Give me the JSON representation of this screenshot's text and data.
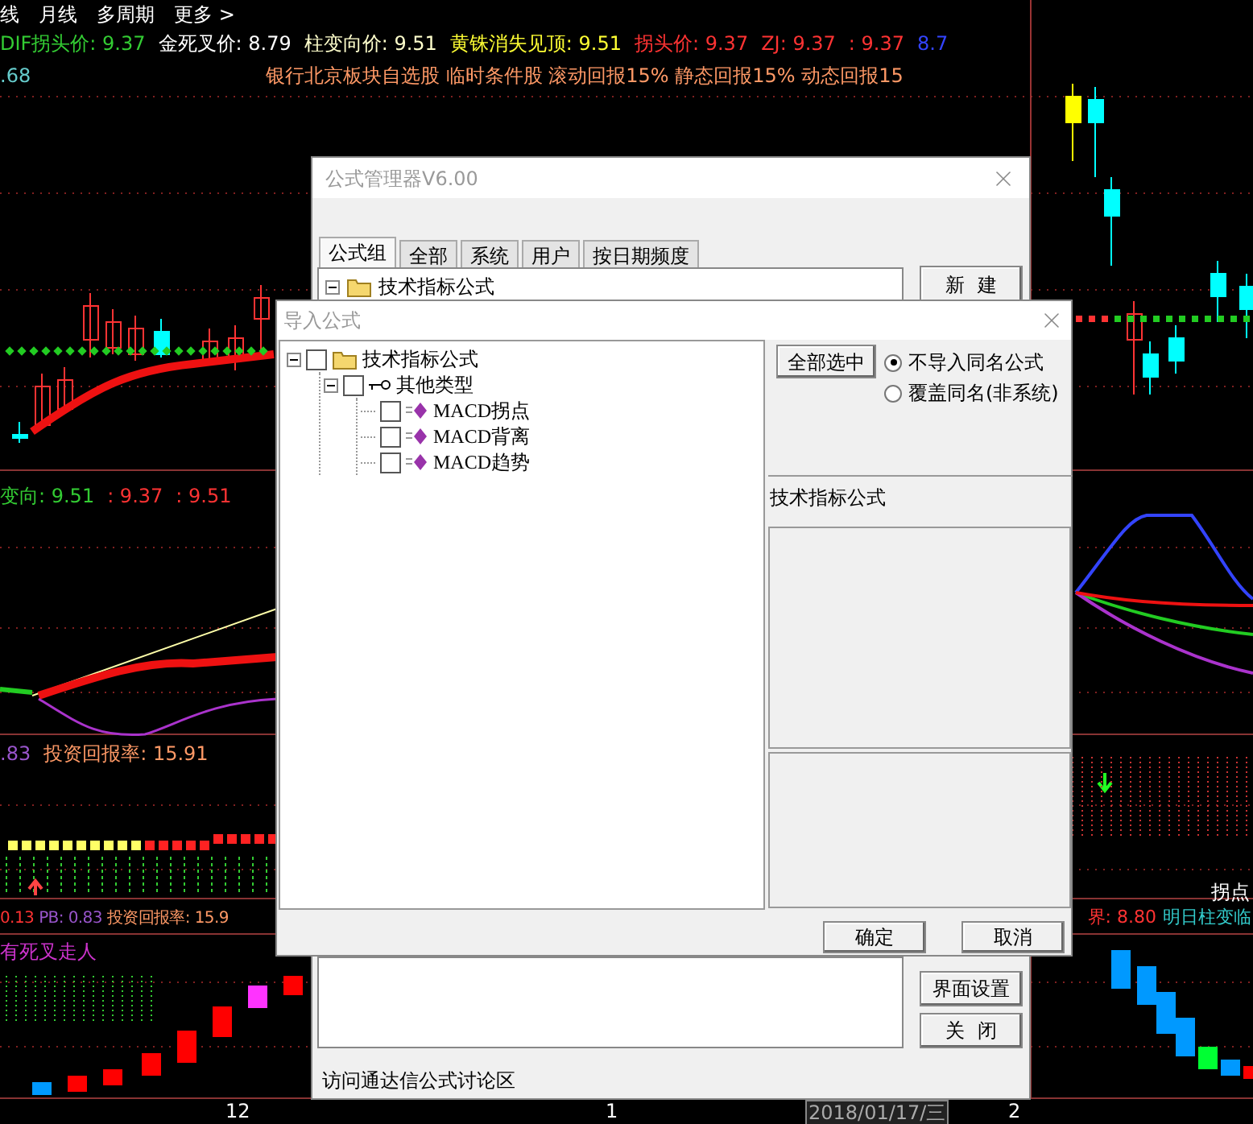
{
  "toolbar": [
    "线",
    "月线",
    "多周期",
    "更多 >"
  ],
  "main_legend": [
    {
      "text": "DIF拐头价: 9.37",
      "color": "#33cc33"
    },
    {
      "text": "金死叉价: 8.79",
      "color": "#ffffff"
    },
    {
      "text": "柱变向价: 9.51",
      "color": "#ffffcc"
    },
    {
      "text": "黄铢消失见顶: 9.51",
      "color": "#ffff33"
    },
    {
      "text": "拐头价: 9.37",
      "color": "#ff3333"
    },
    {
      "text": "ZJ: 9.37",
      "color": "#ff3333"
    },
    {
      "text": ": 9.37",
      "color": "#ff3333"
    },
    {
      "text": "8.7",
      "color": "#3344ff"
    }
  ],
  "main_sub_value": ".68",
  "stock_info": "银行北京板块自选股 临时条件股 滚动回报15% 静态回报15% 动态回报15",
  "panel2_legend": [
    {
      "text": "变向: 9.51",
      "color": "#33cc33"
    },
    {
      "text": ": 9.37",
      "color": "#ff3333"
    },
    {
      "text": ": 9.51",
      "color": "#ff3333"
    }
  ],
  "panel3_legend": [
    {
      "text": ".83",
      "color": "#9955cc"
    },
    {
      "text": "投资回报率: 15.91",
      "color": "#ff9966"
    }
  ],
  "panel3_right": "拐点",
  "panel4_legend": [
    {
      "text": "0.13",
      "color": "#ff3333"
    },
    {
      "text": "PB: 0.83",
      "color": "#9955cc"
    },
    {
      "text": "投资回报率: 15.9",
      "color": "#ff9966"
    }
  ],
  "panel4_right": [
    {
      "text": "界: 8.80",
      "color": "#ff3333"
    },
    {
      "text": "明日柱变临",
      "color": "#33cccc"
    }
  ],
  "panel5_label": "有死叉走人",
  "time_axis": [
    {
      "text": "12",
      "kind": "plain"
    },
    {
      "text": "1",
      "kind": "plain"
    },
    {
      "text": "2018/01/17/三",
      "kind": "cursor"
    },
    {
      "text": "2",
      "kind": "plain"
    }
  ],
  "formula_manager": {
    "title": "公式管理器V6.00",
    "tabs": [
      {
        "label": "公式组",
        "selected": true
      },
      {
        "label": "全部",
        "selected": false
      },
      {
        "label": "系统",
        "selected": false
      },
      {
        "label": "用户",
        "selected": false
      },
      {
        "label": "按日期频度",
        "selected": false
      }
    ],
    "tree": [
      {
        "label": "技术指标公式",
        "expanded": true
      }
    ],
    "buttons": [
      "新  建",
      "界面设置",
      "关  闭"
    ],
    "link": "访问通达信公式讨论区"
  },
  "import_dialog": {
    "title": "导入公式",
    "tree": [
      {
        "label": "技术指标公式",
        "kind": "folder",
        "checked": false,
        "expanded": true,
        "children": [
          {
            "label": "其他类型",
            "kind": "group",
            "checked": false,
            "expanded": true,
            "children": [
              {
                "label": "MACD拐点",
                "kind": "formula",
                "checked": false
              },
              {
                "label": "MACD背离",
                "kind": "formula",
                "checked": false
              },
              {
                "label": "MACD趋势",
                "kind": "formula",
                "checked": false
              }
            ]
          }
        ]
      }
    ],
    "select_all": "全部选中",
    "options": [
      {
        "label": "不导入同名公式",
        "selected": true
      },
      {
        "label": "覆盖同名(非系统)",
        "selected": false
      }
    ],
    "description": "技术指标公式",
    "buttons": [
      "确定",
      "取消"
    ]
  }
}
